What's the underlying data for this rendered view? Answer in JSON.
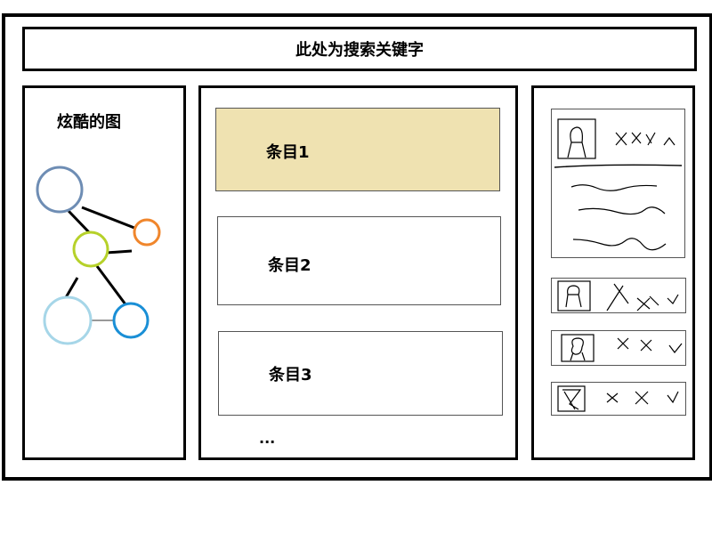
{
  "search": {
    "placeholder_text": "此处为搜索关键字"
  },
  "graph_panel": {
    "title": "炫酷的图",
    "node_colors": [
      "#6e8db4",
      "#f0862c",
      "#b6d12a",
      "#a6d6e8",
      "#1a8fd6"
    ]
  },
  "list": {
    "items": [
      {
        "label": "条目1",
        "selected": true
      },
      {
        "label": "条目2",
        "selected": false
      },
      {
        "label": "条目3",
        "selected": false
      }
    ],
    "more_label": "..."
  },
  "colors": {
    "selected_item_bg": "#efe2b1",
    "border": "#000000"
  },
  "detail_panel": {
    "cards": [
      {
        "icon": "avatar-icon",
        "expanded": true
      },
      {
        "icon": "avatar-icon",
        "expanded": false
      },
      {
        "icon": "avatar-icon",
        "expanded": false
      },
      {
        "icon": "avatar-icon",
        "expanded": false
      }
    ]
  }
}
